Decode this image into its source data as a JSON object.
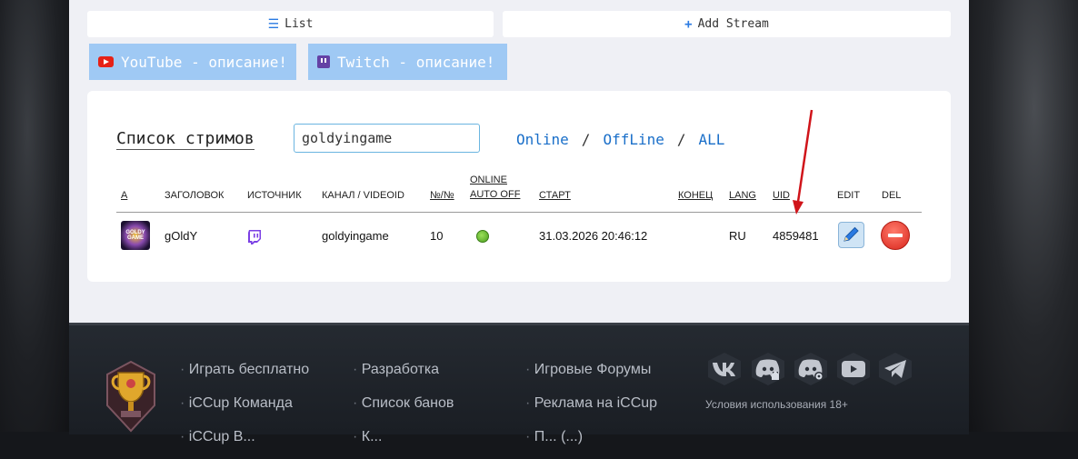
{
  "top_buttons": {
    "list_label": "List",
    "add_label": "Add Stream"
  },
  "promo": {
    "youtube_label": "YouTube - описание!",
    "twitch_label": "Twitch - описание!"
  },
  "streams": {
    "title": "Список стримов",
    "search_value": "goldyingame",
    "filters": {
      "online": "Online",
      "sep": "/",
      "offline": "OffLine",
      "all": "ALL"
    },
    "columns": {
      "a": "A",
      "title": "ЗАГОЛОВОК",
      "source": "ИСТОЧНИК",
      "channel": "КАНАЛ / VIDEOID",
      "num": "№/№",
      "online_1": "ONLINE",
      "online_2": "AUTO OFF",
      "start": "СТАРТ",
      "end": "КОНЕЦ",
      "lang": "LANG",
      "uid": "UID",
      "edit": "EDIT",
      "del": "DEL"
    },
    "rows": [
      {
        "avatar_text": "GOLDY GAME",
        "title": "gOldY",
        "source_icon": "twitch-icon",
        "channel": "goldyingame",
        "num": "10",
        "online": true,
        "start": "31.03.2026 20:46:12",
        "end": "",
        "lang": "RU",
        "uid": "4859481"
      }
    ]
  },
  "footer": {
    "col1": [
      "Играть бесплатно",
      "iCCup Команда",
      "iCCup В..."
    ],
    "col2": [
      "Разработка",
      "Список банов",
      "К..."
    ],
    "col3": [
      "Игровые Форумы",
      "Реклама на iCCup",
      "П... (...)"
    ],
    "social_icons": [
      "vk-icon",
      "discord-home-icon",
      "discord-settings-icon",
      "youtube-icon",
      "telegram-icon"
    ],
    "terms": "Условия использования 18+"
  },
  "colors": {
    "accent": "#1a6fc9",
    "promo": "#9fc9f4",
    "arrow": "#d0141a",
    "online": "#5cb82a"
  }
}
